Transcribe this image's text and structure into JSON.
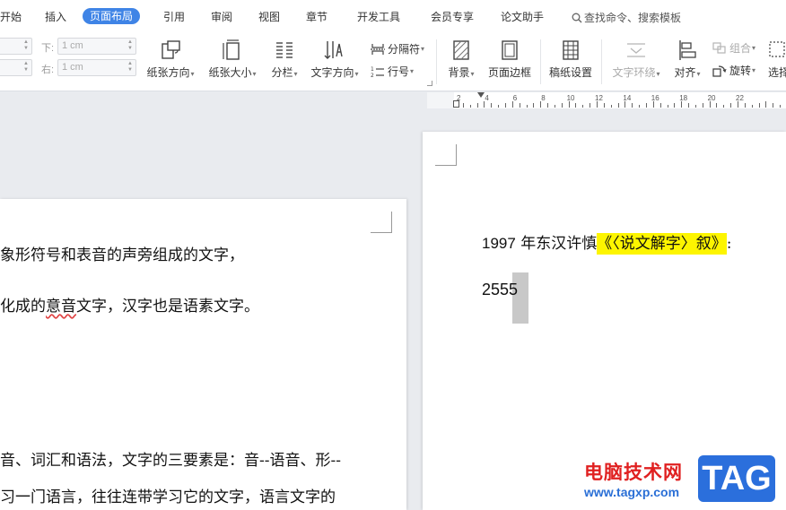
{
  "menubar": {
    "tabs": [
      {
        "label": "开始"
      },
      {
        "label": "插入"
      },
      {
        "label": "页面布局",
        "active": true
      },
      {
        "label": "引用"
      },
      {
        "label": "审阅"
      },
      {
        "label": "视图"
      },
      {
        "label": "章节"
      },
      {
        "label": "开发工具"
      },
      {
        "label": "会员专享"
      },
      {
        "label": "论文助手"
      }
    ],
    "search_label": "查找命令、搜索模板"
  },
  "ribbon": {
    "margins": {
      "bottom_label": "下:",
      "bottom_value": "1 cm",
      "right_label": "右:",
      "right_value": "1 cm"
    },
    "buttons": {
      "orientation": "纸张方向",
      "size": "纸张大小",
      "columns": "分栏",
      "text_direction": "文字方向",
      "breaks": "分隔符",
      "line_numbers": "行号",
      "background": "背景",
      "page_border": "页面边框",
      "manuscript": "稿纸设置",
      "text_wrap": "文字环绕",
      "align": "对齐",
      "group": "组合",
      "rotate": "旋转",
      "select": "选择"
    }
  },
  "ruler": {
    "numbers": [
      "2",
      "4",
      "6",
      "8",
      "10",
      "12",
      "14",
      "16",
      "18",
      "20",
      "22"
    ]
  },
  "document": {
    "left_page_lines": [
      "象形符号和表音的声旁组成的文字，",
      "化成的意音文字，汉字也是语素文字。",
      "音、词汇和语法，文字的三要素是：音--语音、形--",
      "习一门语言，往往连带学习它的文字，语言文字的"
    ],
    "left_wavy_word": "意音",
    "right_page": {
      "line1_year": "1997",
      "line1_text": " 年东汉许慎",
      "line1_highlight": "《〈说文解字〉叙》",
      "line1_tail": ":",
      "line2": "2555"
    }
  },
  "watermark": {
    "site_name": "电脑技术网",
    "url": "www.tagxp.com",
    "badge": "TAG"
  },
  "colors": {
    "active_tab": "#3f84e6",
    "highlight": "#fdf500",
    "watermark_red": "#e02020",
    "watermark_blue": "#2b6fdc"
  }
}
